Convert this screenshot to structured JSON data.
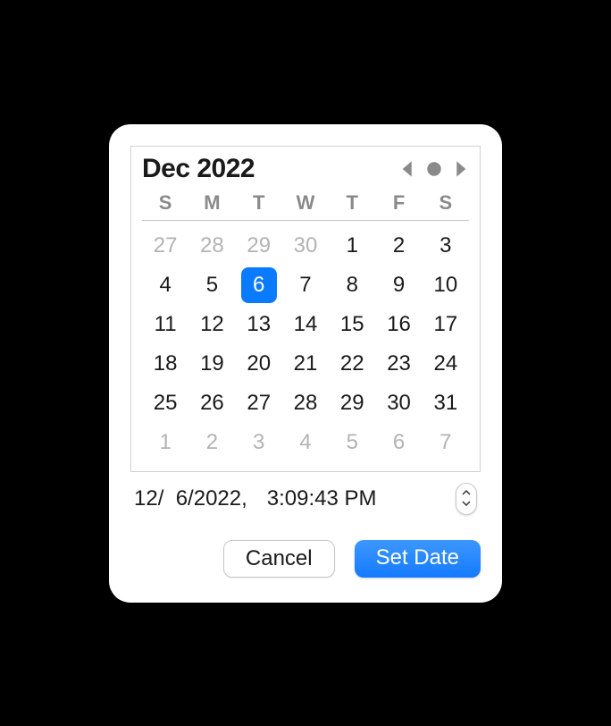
{
  "calendar": {
    "month_year_label": "Dec 2022",
    "day_headers": [
      "S",
      "M",
      "T",
      "W",
      "T",
      "F",
      "S"
    ],
    "weeks": [
      [
        {
          "n": "27",
          "other": true,
          "selected": false
        },
        {
          "n": "28",
          "other": true,
          "selected": false
        },
        {
          "n": "29",
          "other": true,
          "selected": false
        },
        {
          "n": "30",
          "other": true,
          "selected": false
        },
        {
          "n": "1",
          "other": false,
          "selected": false
        },
        {
          "n": "2",
          "other": false,
          "selected": false
        },
        {
          "n": "3",
          "other": false,
          "selected": false
        }
      ],
      [
        {
          "n": "4",
          "other": false,
          "selected": false
        },
        {
          "n": "5",
          "other": false,
          "selected": false
        },
        {
          "n": "6",
          "other": false,
          "selected": true
        },
        {
          "n": "7",
          "other": false,
          "selected": false
        },
        {
          "n": "8",
          "other": false,
          "selected": false
        },
        {
          "n": "9",
          "other": false,
          "selected": false
        },
        {
          "n": "10",
          "other": false,
          "selected": false
        }
      ],
      [
        {
          "n": "11",
          "other": false,
          "selected": false
        },
        {
          "n": "12",
          "other": false,
          "selected": false
        },
        {
          "n": "13",
          "other": false,
          "selected": false
        },
        {
          "n": "14",
          "other": false,
          "selected": false
        },
        {
          "n": "15",
          "other": false,
          "selected": false
        },
        {
          "n": "16",
          "other": false,
          "selected": false
        },
        {
          "n": "17",
          "other": false,
          "selected": false
        }
      ],
      [
        {
          "n": "18",
          "other": false,
          "selected": false
        },
        {
          "n": "19",
          "other": false,
          "selected": false
        },
        {
          "n": "20",
          "other": false,
          "selected": false
        },
        {
          "n": "21",
          "other": false,
          "selected": false
        },
        {
          "n": "22",
          "other": false,
          "selected": false
        },
        {
          "n": "23",
          "other": false,
          "selected": false
        },
        {
          "n": "24",
          "other": false,
          "selected": false
        }
      ],
      [
        {
          "n": "25",
          "other": false,
          "selected": false
        },
        {
          "n": "26",
          "other": false,
          "selected": false
        },
        {
          "n": "27",
          "other": false,
          "selected": false
        },
        {
          "n": "28",
          "other": false,
          "selected": false
        },
        {
          "n": "29",
          "other": false,
          "selected": false
        },
        {
          "n": "30",
          "other": false,
          "selected": false
        },
        {
          "n": "31",
          "other": false,
          "selected": false
        }
      ],
      [
        {
          "n": "1",
          "other": true,
          "selected": false
        },
        {
          "n": "2",
          "other": true,
          "selected": false
        },
        {
          "n": "3",
          "other": true,
          "selected": false
        },
        {
          "n": "4",
          "other": true,
          "selected": false
        },
        {
          "n": "5",
          "other": true,
          "selected": false
        },
        {
          "n": "6",
          "other": true,
          "selected": false
        },
        {
          "n": "7",
          "other": true,
          "selected": false
        }
      ]
    ]
  },
  "datetime": {
    "date_part": "12/  6/2022,",
    "time_part": "3:09:43 PM"
  },
  "buttons": {
    "cancel": "Cancel",
    "set_date": "Set Date"
  },
  "colors": {
    "accent": "#0a7aff"
  }
}
